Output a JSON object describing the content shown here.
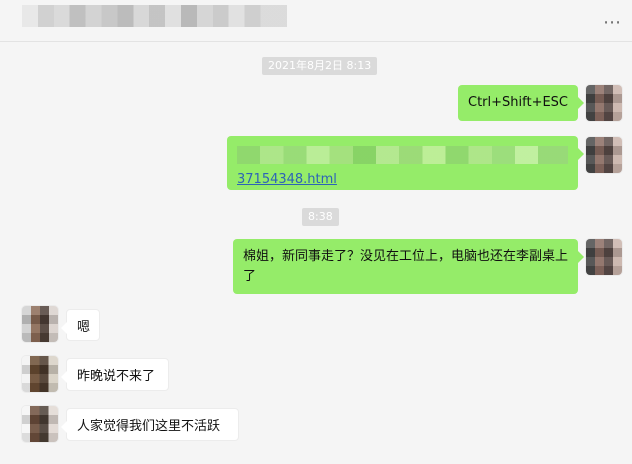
{
  "header": {
    "more_icon": "more-icon"
  },
  "timestamps": [
    "2021年8月2日 8:13",
    "8:38"
  ],
  "messages": {
    "m1": "Ctrl+Shift+ESC",
    "m2_link": "37154348.html",
    "m3": "棉姐，新同事走了？没见在工位上，电脑也还在李副桌上了",
    "m4": "嗯",
    "m5": "昨晚说不来了",
    "m6": "人家觉得我们这里不活跃"
  },
  "colors": {
    "background": "#f5f5f5",
    "my_bubble": "#95ec69",
    "their_bubble": "#ffffff",
    "timestamp_bg": "#dadada",
    "link": "#2d63b7"
  },
  "icons": {
    "more": "more-icon",
    "avatar": "avatar"
  }
}
